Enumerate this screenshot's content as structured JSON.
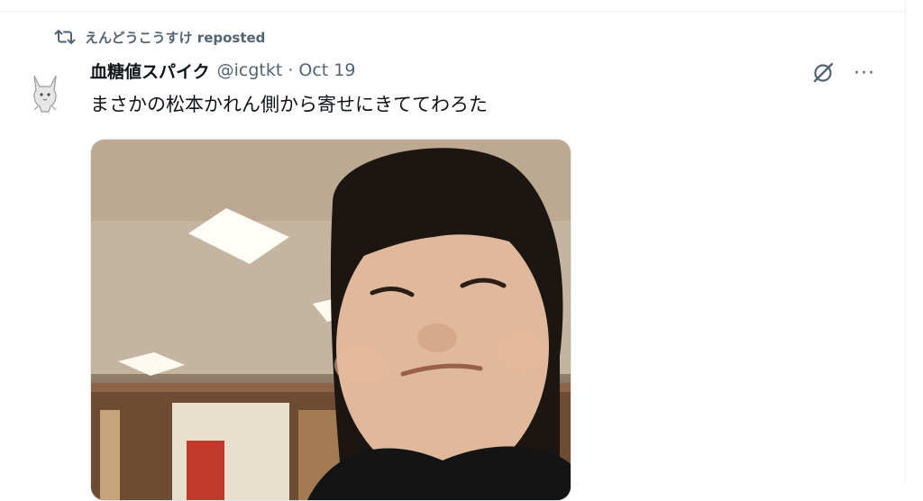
{
  "repost": {
    "icon": "repost-icon",
    "reposter_name": "えんどうこうすけ",
    "label": "reposted"
  },
  "tweet": {
    "author": {
      "display_name": "血糖値スパイク",
      "handle": "@icgtkt",
      "separator": "·",
      "date": "Oct 19",
      "avatar_icon": "cat-avatar"
    },
    "text": "まさかの松本かれん側から寄せにきててわろた",
    "actions": {
      "grok_icon": "grok-icon",
      "more_icon": "more-icon",
      "more_glyph": "···"
    },
    "media": {
      "type": "photo",
      "description_icon": "photo"
    }
  },
  "colors": {
    "text_primary": "#0f1419",
    "text_secondary": "#536471",
    "divider": "#eff3f4"
  }
}
